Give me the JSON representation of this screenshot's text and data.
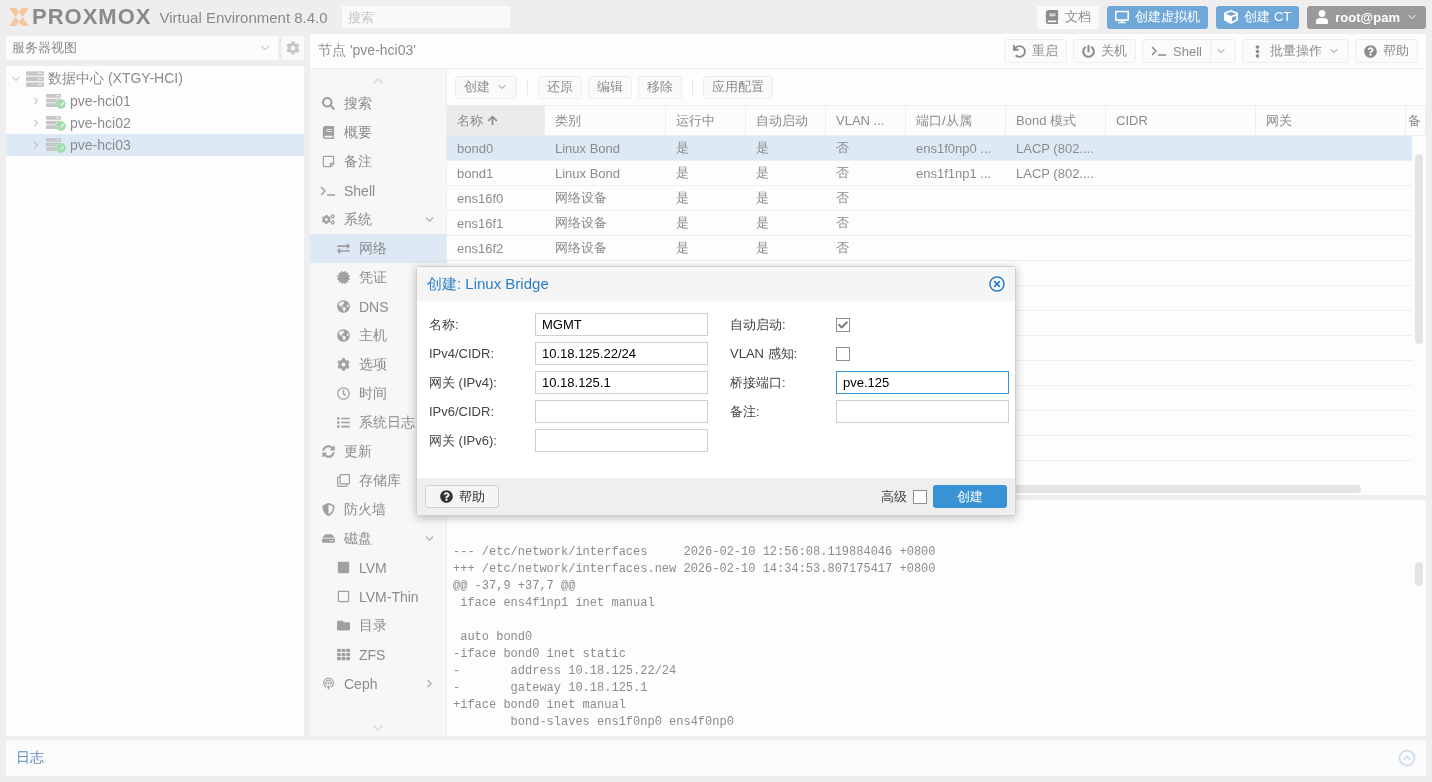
{
  "topbar": {
    "logo": "PROXMOX",
    "product": "Virtual Environment 8.4.0",
    "search": {
      "placeholder": "搜索"
    },
    "buttons": [
      {
        "label": "文档",
        "kind": "plain"
      },
      {
        "label": "创建虚拟机",
        "kind": "primary"
      },
      {
        "label": "创建 CT",
        "kind": "primary"
      },
      {
        "label": "root@pam",
        "kind": "user"
      }
    ]
  },
  "sidebar": {
    "view_select": {
      "value": "服务器视图"
    },
    "tree": [
      {
        "label": "数据中心 (XTGY-HCI)",
        "expanded": true,
        "selected": false,
        "children": [
          {
            "label": "pve-hci01",
            "expanded": false,
            "selected": false
          },
          {
            "label": "pve-hci02",
            "expanded": false,
            "selected": false
          },
          {
            "label": "pve-hci03",
            "expanded": false,
            "selected": true
          }
        ]
      }
    ]
  },
  "node_header": {
    "title": "节点 'pve-hci03'",
    "buttons": [
      {
        "label": "重启",
        "split": false,
        "dropdown": false
      },
      {
        "label": "关机",
        "split": false,
        "dropdown": false
      },
      {
        "label": "Shell",
        "split": true,
        "dropdown": false
      },
      {
        "label": "批量操作",
        "split": false,
        "dropdown": true
      },
      {
        "label": "帮助",
        "split": false,
        "dropdown": false
      }
    ]
  },
  "nav": [
    {
      "label": "搜索",
      "selected": false
    },
    {
      "label": "概要",
      "selected": false
    },
    {
      "label": "备注",
      "selected": false
    },
    {
      "label": "Shell",
      "selected": false
    },
    {
      "label": "系统",
      "selected": false,
      "expanded": true,
      "children": [
        {
          "label": "网络",
          "selected": true
        },
        {
          "label": "凭证",
          "selected": false
        },
        {
          "label": "DNS",
          "selected": false
        },
        {
          "label": "主机",
          "selected": false
        },
        {
          "label": "选项",
          "selected": false
        },
        {
          "label": "时间",
          "selected": false
        },
        {
          "label": "系统日志",
          "selected": false
        }
      ]
    },
    {
      "label": "更新",
      "selected": false,
      "children": [
        {
          "label": "存储库",
          "selected": false
        }
      ]
    },
    {
      "label": "防火墙",
      "selected": false
    },
    {
      "label": "磁盘",
      "selected": false,
      "expanded": true,
      "children": [
        {
          "label": "LVM",
          "selected": false
        },
        {
          "label": "LVM-Thin",
          "selected": false
        },
        {
          "label": "目录",
          "selected": false
        },
        {
          "label": "ZFS",
          "selected": false
        }
      ]
    },
    {
      "label": "Ceph",
      "selected": false,
      "expanded": false
    }
  ],
  "grid": {
    "toolbar_groups": [
      {
        "buttons": [
          {
            "label": "创建",
            "dropdown": true
          }
        ]
      },
      {
        "buttons": [
          {
            "label": "还原",
            "dropdown": false
          },
          {
            "label": "编辑",
            "dropdown": false
          },
          {
            "label": "移除",
            "dropdown": false
          }
        ]
      },
      {
        "buttons": [
          {
            "label": "应用配置",
            "dropdown": false
          }
        ]
      }
    ],
    "columns": [
      {
        "label": "名称",
        "sorted": true
      },
      {
        "label": "类别",
        "sorted": false
      },
      {
        "label": "运行中",
        "sorted": false
      },
      {
        "label": "自动启动",
        "sorted": false
      },
      {
        "label": "VLAN ...",
        "sorted": false
      },
      {
        "label": "端口/从属",
        "sorted": false
      },
      {
        "label": "Bond 模式",
        "sorted": false
      },
      {
        "label": "CIDR",
        "sorted": false
      },
      {
        "label": "网关",
        "sorted": false
      },
      {
        "label": "备",
        "sorted": false
      }
    ],
    "rows": [
      {
        "selected": true,
        "cells": [
          "bond0",
          "Linux Bond",
          "是",
          "是",
          "否",
          "ens1f0np0 ...",
          "LACP (802...."
        ]
      },
      {
        "selected": false,
        "cells": [
          "bond1",
          "Linux Bond",
          "是",
          "是",
          "否",
          "ens1f1np1 ...",
          "LACP (802...."
        ]
      },
      {
        "selected": false,
        "cells": [
          "ens16f0",
          "网络设备",
          "是",
          "是",
          "否"
        ]
      },
      {
        "selected": false,
        "cells": [
          "ens16f1",
          "网络设备",
          "是",
          "是",
          "否"
        ]
      },
      {
        "selected": false,
        "cells": [
          "ens16f2",
          "网络设备",
          "是",
          "是",
          "否"
        ]
      }
    ]
  },
  "diff": {
    "text": "--- /etc/network/interfaces     2026-02-10 12:56:08.119884046 +0800\n+++ /etc/network/interfaces.new 2026-02-10 14:34:53.807175417 +0800\n@@ -37,9 +37,7 @@\n iface ens4f1np1 inet manual\n\n auto bond0\n-iface bond0 inet static\n-       address 10.18.125.22/24\n-       gateway 10.18.125.1\n+iface bond0 inet manual\n        bond-slaves ens1f0np0 ens4f0np0"
  },
  "log_panel": {
    "title": "日志"
  },
  "dialog": {
    "title": "创建: Linux Bridge",
    "left_fields": [
      {
        "label": "名称:",
        "kind": "text",
        "value": "MGMT",
        "focused": false
      },
      {
        "label": "IPv4/CIDR:",
        "kind": "text",
        "value": "10.18.125.22/24",
        "focused": false
      },
      {
        "label": "网关 (IPv4):",
        "kind": "text",
        "value": "10.18.125.1",
        "focused": false
      },
      {
        "label": "IPv6/CIDR:",
        "kind": "text",
        "focused": false
      },
      {
        "label": "网关 (IPv6):",
        "kind": "text",
        "focused": false
      }
    ],
    "right_fields": [
      {
        "label": "自动启动:",
        "kind": "checkbox",
        "checked": true
      },
      {
        "label": "VLAN 感知:",
        "kind": "checkbox",
        "checked": false
      },
      {
        "label": "桥接端口:",
        "kind": "text",
        "value": "pve.125",
        "focused": true
      },
      {
        "label": "备注:",
        "kind": "text",
        "focused": false
      }
    ],
    "help_button": "帮助",
    "advanced": {
      "label": "高级",
      "checked": false
    },
    "submit_button": "创建"
  }
}
